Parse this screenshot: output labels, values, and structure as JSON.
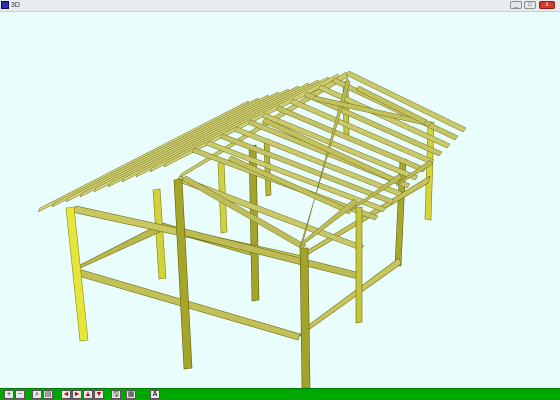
{
  "window": {
    "title": "3D"
  },
  "titlebar_buttons": {
    "minimize": "_",
    "maximize": "□",
    "close": "x"
  },
  "viewport": {
    "label": "3d-roof-frame-view",
    "background": "#eafdfd",
    "member_color": "#c9c86a",
    "post_color": "#e0df3a"
  },
  "toolbar": {
    "zoom_in": "+",
    "zoom_out": "−",
    "zoom_fit": "⌕",
    "print": "▤",
    "rot_left": "◄",
    "rot_right": "►",
    "rot_up": "▲",
    "rot_down": "▼",
    "save": "🖫",
    "copy": "▦",
    "text": "A"
  }
}
